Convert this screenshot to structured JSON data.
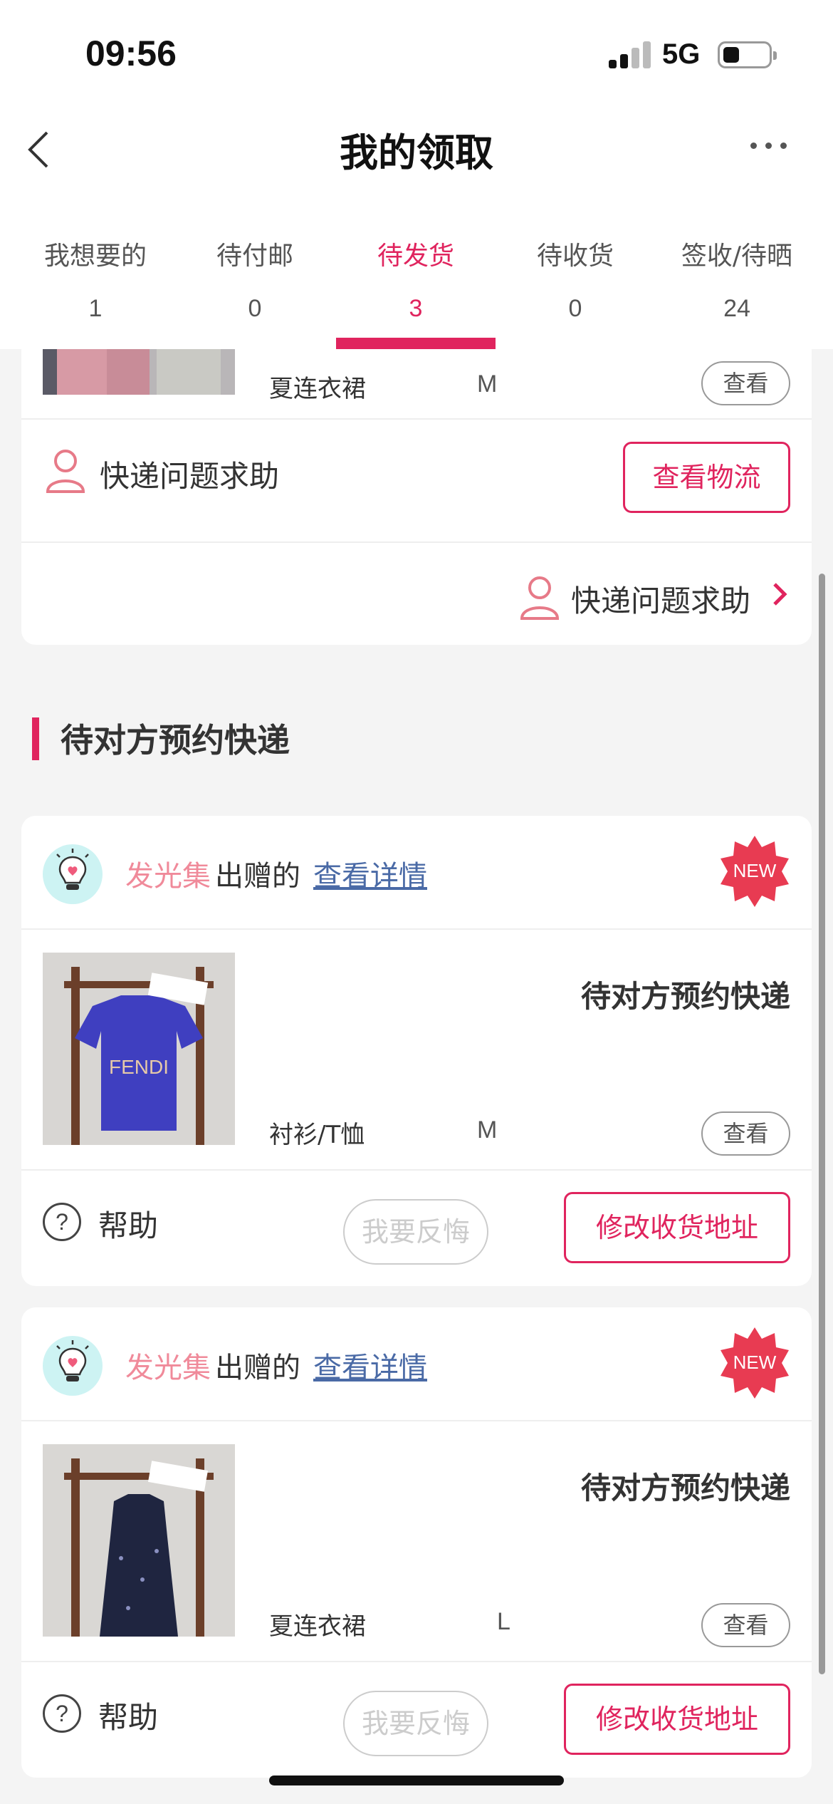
{
  "status_bar": {
    "time": "09:56",
    "network": "5G"
  },
  "nav": {
    "title": "我的领取"
  },
  "tabs": [
    {
      "label": "我想要的",
      "count": "1"
    },
    {
      "label": "待付邮",
      "count": "0"
    },
    {
      "label": "待发货",
      "count": "3",
      "active": true
    },
    {
      "label": "待收货",
      "count": "0"
    },
    {
      "label": "签收/待晒",
      "count": "24"
    }
  ],
  "card_top": {
    "item_name": "夏连衣裙",
    "size": "M",
    "view_label": "查看",
    "express_help": "快递问题求助",
    "logistics_button": "查看物流",
    "express_help_link": "快递问题求助"
  },
  "section": {
    "title": "待对方预约快递"
  },
  "cards": [
    {
      "giver": "发光集",
      "gave_text": "出赠的",
      "detail_link": "查看详情",
      "badge": "NEW",
      "status": "待对方预约快递",
      "item_name": "衬衫/T恤",
      "size": "M",
      "view_label": "查看",
      "shirt_text": "FENDI",
      "help_label": "帮助",
      "regret_button": "我要反悔",
      "address_button": "修改收货地址"
    },
    {
      "giver": "发光集",
      "gave_text": "出赠的",
      "detail_link": "查看详情",
      "badge": "NEW",
      "status": "待对方预约快递",
      "item_name": "夏连衣裙",
      "size": "L",
      "view_label": "查看",
      "help_label": "帮助",
      "regret_button": "我要反悔",
      "address_button": "修改收货地址"
    }
  ],
  "colors": {
    "accent": "#e0245e",
    "giver": "#f08a9a",
    "link": "#4a6aa6",
    "background": "#f4f4f4"
  }
}
